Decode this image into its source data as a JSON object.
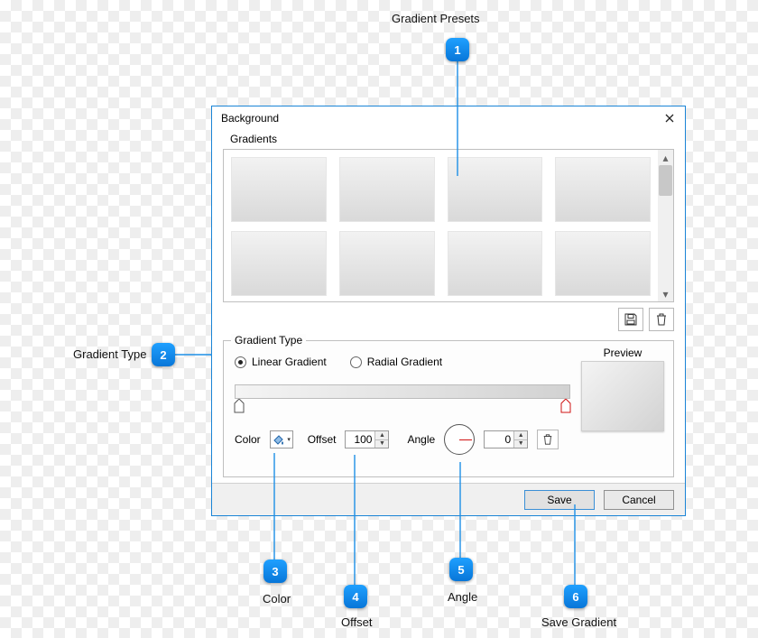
{
  "annotations": {
    "callouts": [
      {
        "num": "1",
        "label": "Gradient Presets"
      },
      {
        "num": "2",
        "label": "Gradient Type"
      },
      {
        "num": "3",
        "label": "Color"
      },
      {
        "num": "4",
        "label": "Offset"
      },
      {
        "num": "5",
        "label": "Angle"
      },
      {
        "num": "6",
        "label": "Save Gradient"
      }
    ]
  },
  "dialog": {
    "title": "Background",
    "gradients_label": "Gradients",
    "gradient_type": {
      "legend": "Gradient Type",
      "linear": "Linear Gradient",
      "radial": "Radial Gradient",
      "selected": "linear"
    },
    "preview_label": "Preview",
    "controls": {
      "color_label": "Color",
      "offset_label": "Offset",
      "offset_value": "100",
      "angle_label": "Angle",
      "angle_value": "0"
    },
    "footer": {
      "save": "Save",
      "cancel": "Cancel"
    }
  }
}
